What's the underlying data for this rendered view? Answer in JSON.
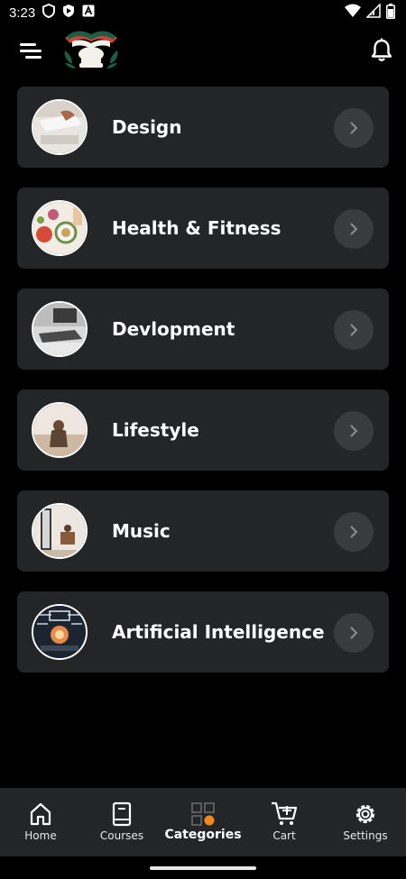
{
  "status_bar": {
    "time": "3:23",
    "icons": [
      "shield-icon",
      "play-protect-icon",
      "font-icon",
      "wifi-icon",
      "signal-icon",
      "battery-icon"
    ]
  },
  "header": {
    "menu_icon": "menu-icon",
    "logo": "book-leaf-logo",
    "bell_icon": "bell-icon"
  },
  "categories": [
    {
      "label": "Design",
      "arrow_icon": "chevron-right-icon"
    },
    {
      "label": "Health & Fitness",
      "arrow_icon": "chevron-right-icon"
    },
    {
      "label": "Devlopment",
      "arrow_icon": "chevron-right-icon"
    },
    {
      "label": "Lifestyle",
      "arrow_icon": "chevron-right-icon"
    },
    {
      "label": "Music",
      "arrow_icon": "chevron-right-icon"
    },
    {
      "label": "Artificial Intelligence",
      "arrow_icon": "chevron-right-icon"
    }
  ],
  "bottom_nav": {
    "items": [
      {
        "label": "Home",
        "icon": "home-icon"
      },
      {
        "label": "Courses",
        "icon": "book-icon"
      },
      {
        "label": "Categories",
        "icon": "grid-icon",
        "active": true
      },
      {
        "label": "Cart",
        "icon": "cart-plus-icon"
      },
      {
        "label": "Settings",
        "icon": "gear-icon"
      }
    ]
  },
  "colors": {
    "background": "#000000",
    "card": "#232527",
    "arrow_bg": "#393b3d",
    "nav_bg": "#232527",
    "accent": "#f08a1c",
    "logo_green": "#1f5c45",
    "logo_red": "#c8463a"
  }
}
